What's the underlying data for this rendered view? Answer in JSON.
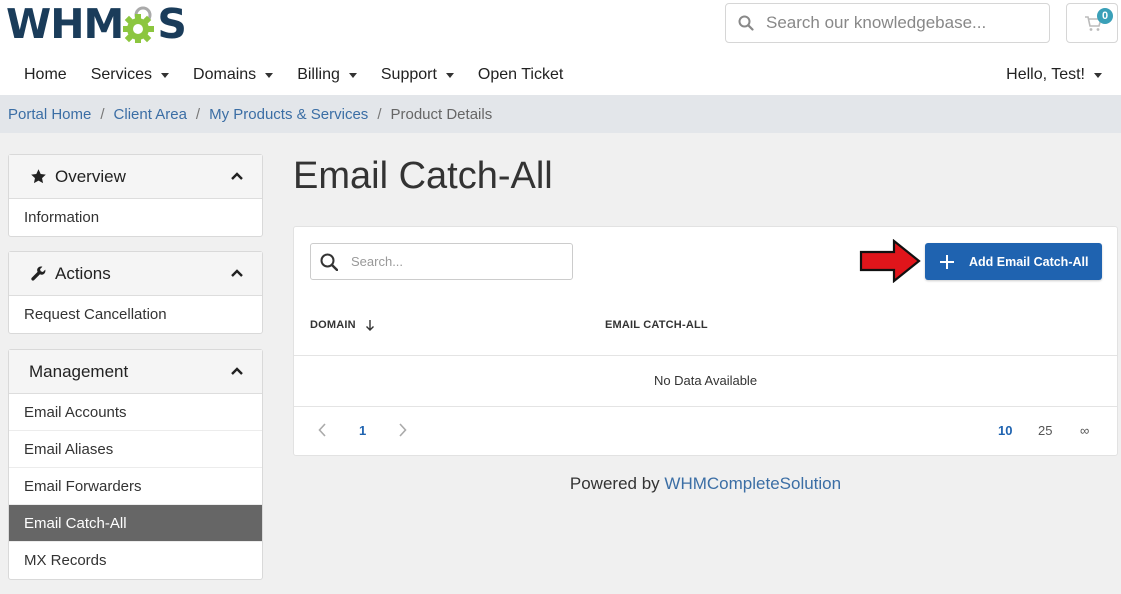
{
  "header": {
    "logo_text_left": "WHM",
    "logo_text_right": "S",
    "search_placeholder": "Search our knowledgebase...",
    "cart_count": "0"
  },
  "nav": {
    "items": [
      {
        "label": "Home",
        "dropdown": false
      },
      {
        "label": "Services",
        "dropdown": true
      },
      {
        "label": "Domains",
        "dropdown": true
      },
      {
        "label": "Billing",
        "dropdown": true
      },
      {
        "label": "Support",
        "dropdown": true
      },
      {
        "label": "Open Ticket",
        "dropdown": false
      }
    ],
    "user": "Hello, Test!"
  },
  "breadcrumb": {
    "items": [
      "Portal Home",
      "Client Area",
      "My Products & Services"
    ],
    "current": "Product Details"
  },
  "sidebar": {
    "overview": {
      "title": "Overview",
      "items": [
        "Information"
      ]
    },
    "actions": {
      "title": "Actions",
      "items": [
        "Request Cancellation"
      ]
    },
    "management": {
      "title": "Management",
      "items": [
        "Email Accounts",
        "Email Aliases",
        "Email Forwarders",
        "Email Catch-All",
        "MX Records"
      ],
      "active": "Email Catch-All"
    }
  },
  "main": {
    "title": "Email Catch-All",
    "table_search_placeholder": "Search...",
    "add_button_label": "Add Email Catch-All",
    "columns": [
      "DOMAIN",
      "EMAIL CATCH-ALL"
    ],
    "empty_text": "No Data Available",
    "pagination": {
      "current_page": "1",
      "page_sizes": [
        "10",
        "25",
        "∞"
      ],
      "selected_size": "10"
    }
  },
  "footer": {
    "prefix": "Powered by",
    "link": "WHMCompleteSolution"
  },
  "colors": {
    "primary": "#1f63b0",
    "brand_dark": "#1a3c5a",
    "brand_green": "#8cc63f",
    "link": "#3b6ea5",
    "active_item": "#666666",
    "arrow_red": "#e0151b"
  }
}
